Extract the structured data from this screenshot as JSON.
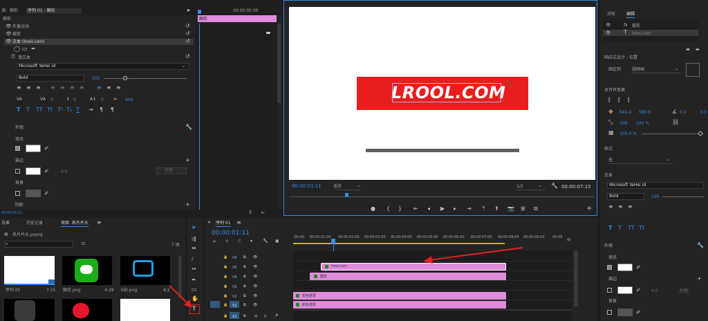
{
  "effect_controls": {
    "header_tab": "源：图形",
    "sequence_tab": "序列 01 - 图形",
    "section": "图形",
    "timeline_time": "00:00:05:00",
    "graphic_clip": "图形",
    "effects": [
      "矢量运动",
      "裁剪"
    ],
    "text_layer": "文本 (lrool.com)",
    "source_text": "源文本",
    "font": "Microsoft YaHei UI",
    "weight": "Bold",
    "size": "105",
    "kerning": "0",
    "tracking": "0",
    "leading": "0",
    "baseline": "0",
    "tsume": "400",
    "appearance": "外观",
    "fill": "填充",
    "stroke": "描边",
    "stroke_width": "4.0",
    "stroke_mode": "外侧",
    "background": "背景",
    "shadow": "阴影",
    "bottom_time": "00:00:01:11"
  },
  "program": {
    "title_text": "LROOL.COM",
    "timecode": "00:00:01:11",
    "fit": "适合",
    "quality": "1/2",
    "duration": "00:00:07:15",
    "colors": {
      "banner": "#e81d1d",
      "bar": "#5f5f5f"
    }
  },
  "project": {
    "tabs": [
      "效果",
      "历史记录",
      "项目: 名片片头"
    ],
    "file": "名片片头.prproj",
    "count": "7 项",
    "items": [
      {
        "name": "序列 01",
        "meta": "7:15"
      },
      {
        "name": "微信.png",
        "meta": "4;29"
      },
      {
        "name": "b站.png",
        "meta": "4;2"
      }
    ]
  },
  "timeline": {
    "tab": "序列 01",
    "timecode": "00:00:01:11",
    "ruler": [
      ":00:00",
      "00:00:01:00",
      "00:00:02:00",
      "00:00:03:00",
      "00:00:04:00",
      "00:00:05:00",
      "00:00:06:00",
      "00:00:07:00",
      "00:00:08:00",
      "00:00:09:00",
      "00:00"
    ],
    "tracks": [
      "V6",
      "V5",
      "V4",
      "V3",
      "V2",
      "V1",
      "A1"
    ],
    "clips": [
      {
        "track": "V5",
        "label": "lrool.com"
      },
      {
        "track": "V4",
        "label": "图形"
      },
      {
        "track": "V2",
        "label": "颜色遮罩"
      },
      {
        "track": "V1",
        "label": "颜色遮罩"
      }
    ]
  },
  "essential_graphics": {
    "tabs": [
      "浏览",
      "编辑"
    ],
    "layers": [
      "裁剪",
      "lrool.com"
    ],
    "responsive": "响应式设计 - 位置",
    "pin_label": "固定到",
    "pin_value": "视频帧",
    "align": "对齐并变换",
    "pos_x": "641.9",
    "pos_y": "580.6",
    "rotation": "0.0",
    "anchor": "0.0",
    "scale_w": "100",
    "scale_h": "100 %",
    "opacity": "100.0 %",
    "style": "样式",
    "style_value": "无",
    "text": "文本",
    "font": "Microsoft YaHei UI",
    "weight": "Bold",
    "size": "105",
    "appearance": "外观",
    "fill": "填充",
    "stroke": "描边",
    "stroke_width": "4.0",
    "stroke_mode": "外侧",
    "background": "背景"
  }
}
